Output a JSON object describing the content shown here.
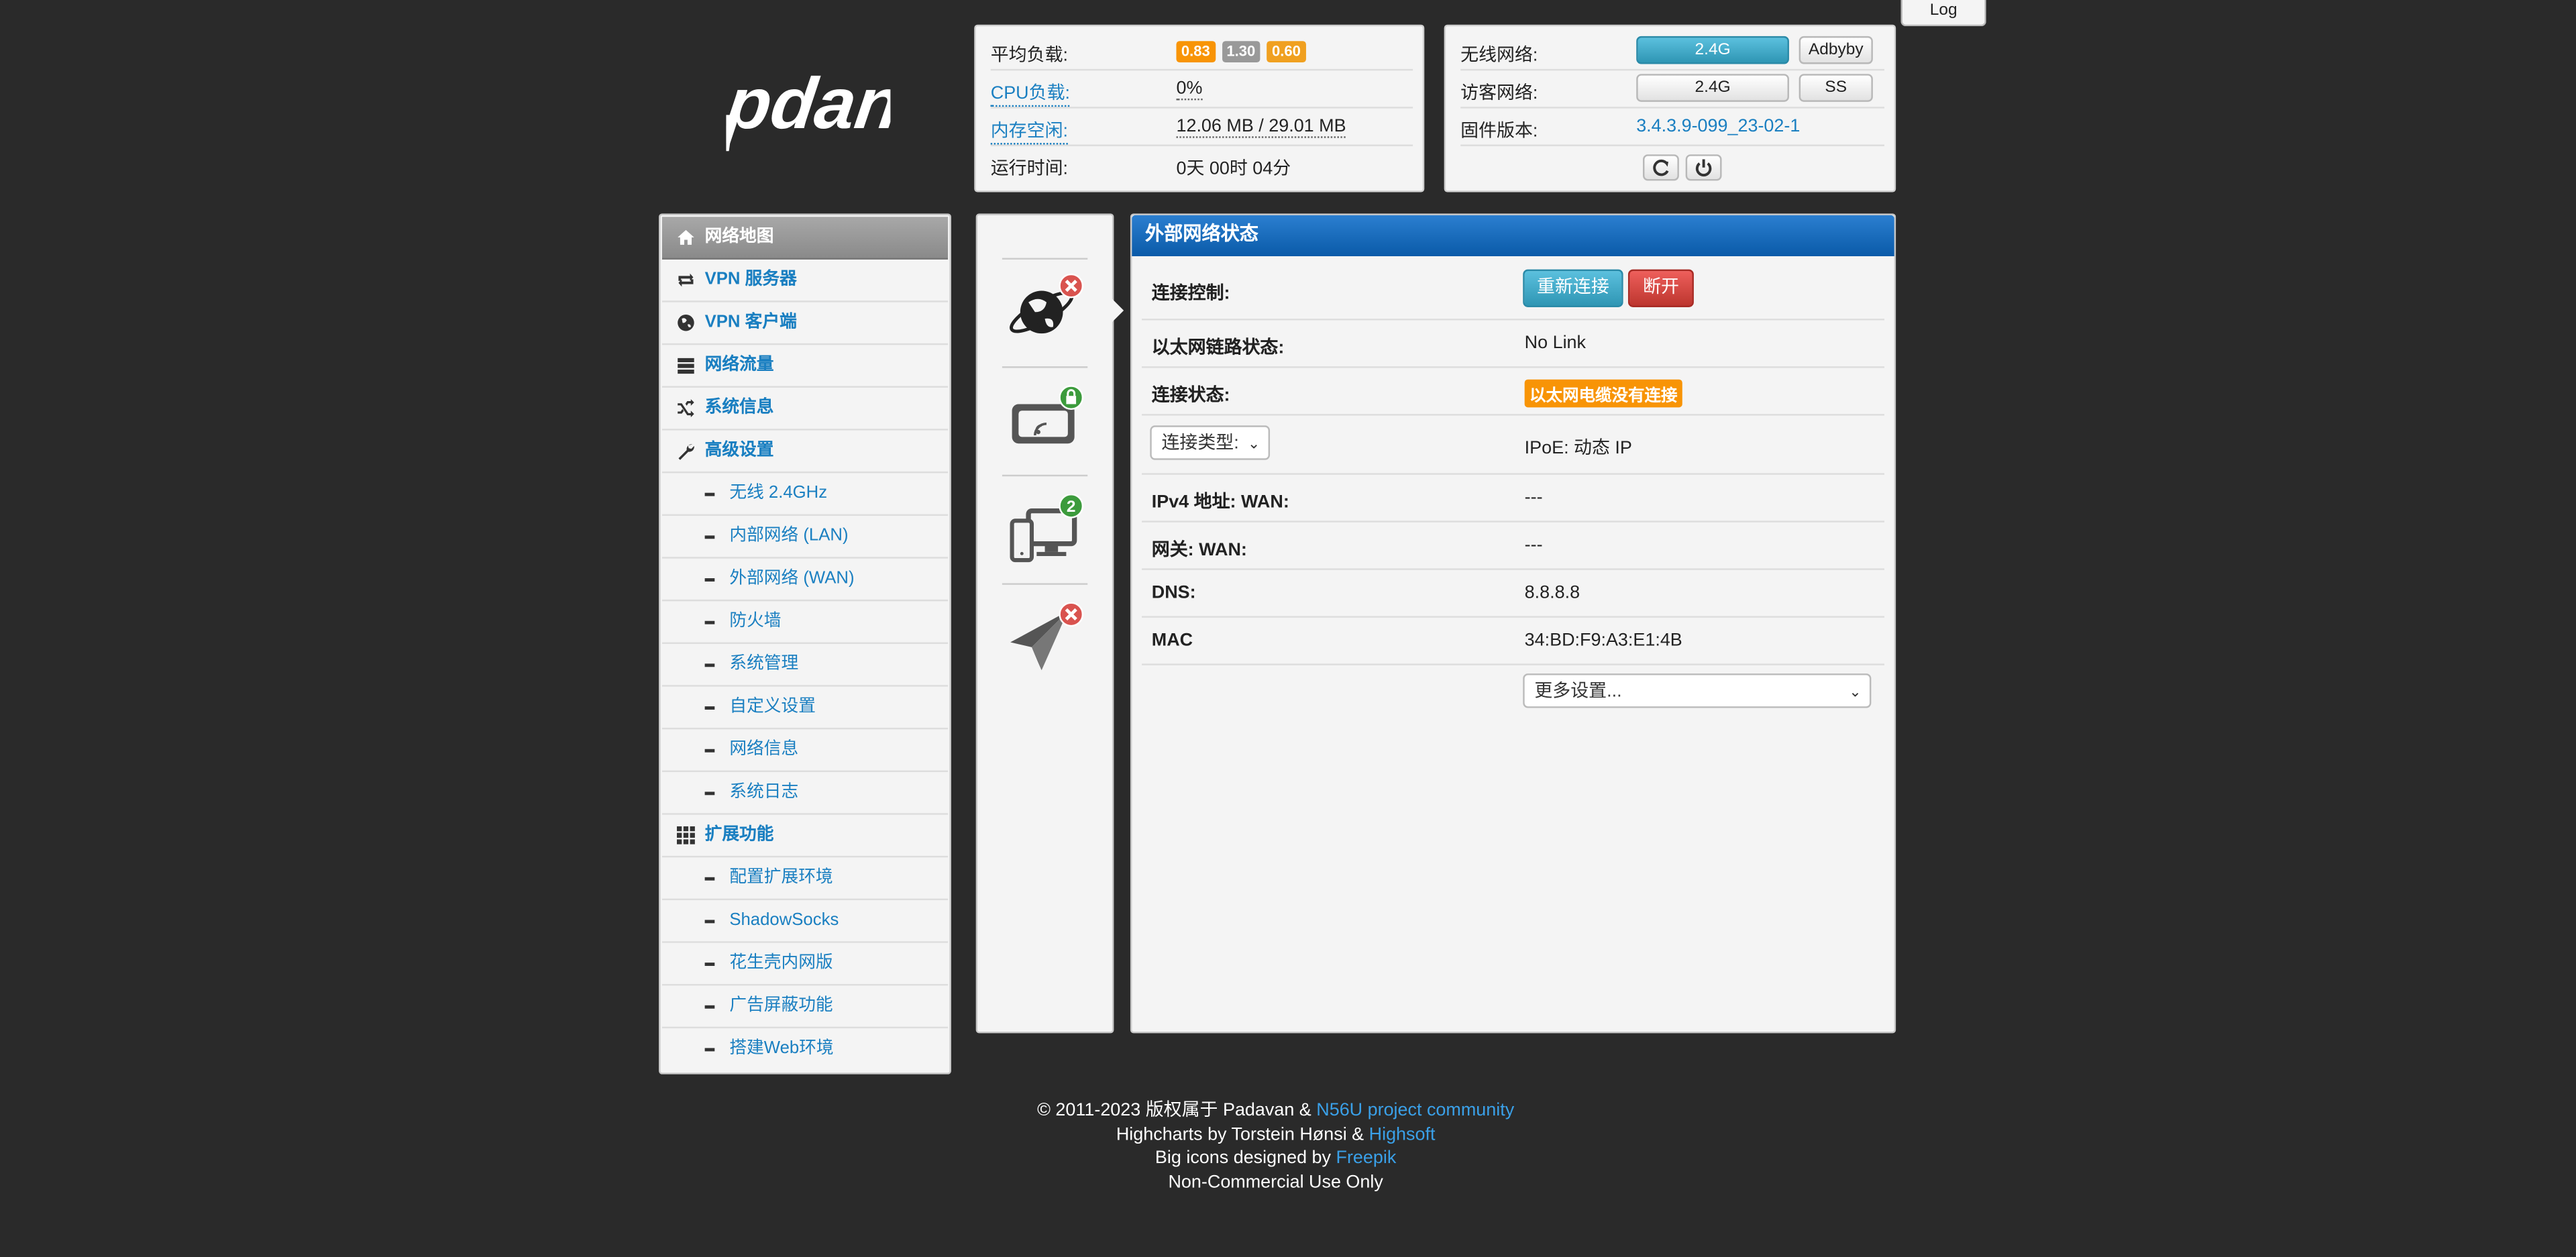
{
  "log_button": "Log",
  "logo_text": "pdan",
  "system": {
    "load_label": "平均负载:",
    "load_values": [
      "0.83",
      "1.30",
      "0.60"
    ],
    "cpu_label": "CPU负载:",
    "cpu_value": "0%",
    "mem_label": "内存空闲:",
    "mem_value": "12.06 MB / 29.01 MB",
    "uptime_label": "运行时间:",
    "uptime_value": "0天 00时 04分"
  },
  "wireless": {
    "wifi_label": "无线网络:",
    "wifi_btn": "2.4G",
    "adbyby_btn": "Adbyby",
    "guest_label": "访客网络:",
    "guest_btn": "2.4G",
    "ss_btn": "SS",
    "firmware_label": "固件版本:",
    "firmware_value": "3.4.3.9-099_23-02-1",
    "refresh_icon": "refresh-icon",
    "power_icon": "power-icon"
  },
  "sidebar": {
    "items": [
      {
        "label": "网络地图",
        "icon": "home-icon",
        "active": true
      },
      {
        "label": "VPN 服务器",
        "icon": "retweet-icon"
      },
      {
        "label": "VPN 客户端",
        "icon": "globe-icon"
      },
      {
        "label": "网络流量",
        "icon": "tasks-icon"
      },
      {
        "label": "系统信息",
        "icon": "random-icon"
      },
      {
        "label": "高级设置",
        "icon": "wrench-icon"
      }
    ],
    "advanced_sub": [
      "无线 2.4GHz",
      "内部网络 (LAN)",
      "外部网络 (WAN)",
      "防火墙",
      "系统管理",
      "自定义设置",
      "网络信息",
      "系统日志"
    ],
    "ext_label": "扩展功能",
    "ext_icon": "th-icon",
    "ext_sub": [
      "配置扩展环境",
      "ShadowSocks",
      "花生壳内网版",
      "广告屏蔽功能",
      "搭建Web环境"
    ]
  },
  "status_icons": {
    "internet_badge": "×",
    "router_badge": "lock",
    "clients_count": "2",
    "usb_badge": "×"
  },
  "wan": {
    "title": "外部网络状态",
    "control_label": "连接控制:",
    "reconnect_btn": "重新连接",
    "disconnect_btn": "断开",
    "link_label": "以太网链路状态:",
    "link_value": "No Link",
    "status_label": "连接状态:",
    "status_value": "以太网电缆没有连接",
    "type_select": "连接类型:",
    "type_value": "IPoE: 动态 IP",
    "ipv4_label": "IPv4 地址: WAN:",
    "ipv4_value": "---",
    "gw_label": "网关: WAN:",
    "gw_value": "---",
    "dns_label": "DNS:",
    "dns_value": "8.8.8.8",
    "mac_label": "MAC",
    "mac_value": "34:BD:F9:A3:E1:4B",
    "more_select": "更多设置..."
  },
  "footer": {
    "line1_pre": "© 2011-2023 版权属于 Padavan & ",
    "line1_link": "N56U project community",
    "line2_pre": "Highcharts by Torstein Hønsi & ",
    "line2_link": "Highsoft",
    "line3_pre": "Big icons designed by ",
    "line3_link": "Freepik",
    "line4": "Non-Commercial Use Only"
  }
}
